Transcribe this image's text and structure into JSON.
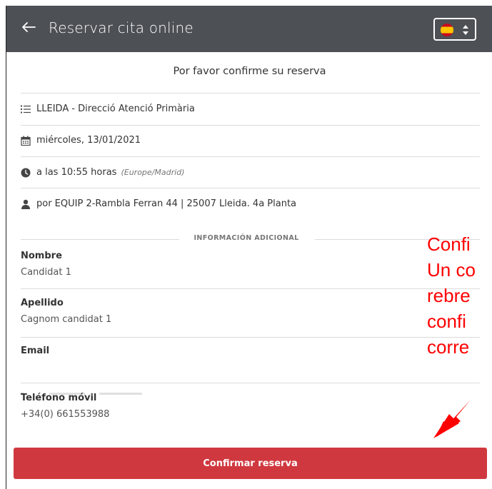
{
  "header": {
    "title": "Reservar cita online",
    "back_icon": "arrow-left-icon",
    "language_flag": "spain-flag-icon"
  },
  "confirm_heading": "Por favor confirme su reserva",
  "details": {
    "service": "LLEIDA - Direcció Atenció Primària",
    "date": "miércoles, 13/01/2021",
    "time": "a las 10:55 horas",
    "timezone": "(Europe/Madrid)",
    "provider": "por EQUIP 2-Rambla Ferran 44 | 25007 Lleida. 4a Planta"
  },
  "additional_info": {
    "section_title": "INFORMACIÓN ADICIONAL",
    "fields": [
      {
        "label": "Nombre",
        "value": "Candidat 1"
      },
      {
        "label": "Apellido",
        "value": "Cagnom candidat 1"
      },
      {
        "label": "Email",
        "value": ""
      },
      {
        "label": "Teléfono móvil",
        "value": "+34(0) 661553988"
      }
    ]
  },
  "confirm_button_label": "Confirmar reserva",
  "annotation": {
    "lines": [
      "Confi",
      "Un co",
      "rebre",
      "confi",
      "corre"
    ],
    "color": "#ff0000"
  },
  "colors": {
    "topbar": "#4d5156",
    "button": "#d0383f"
  }
}
